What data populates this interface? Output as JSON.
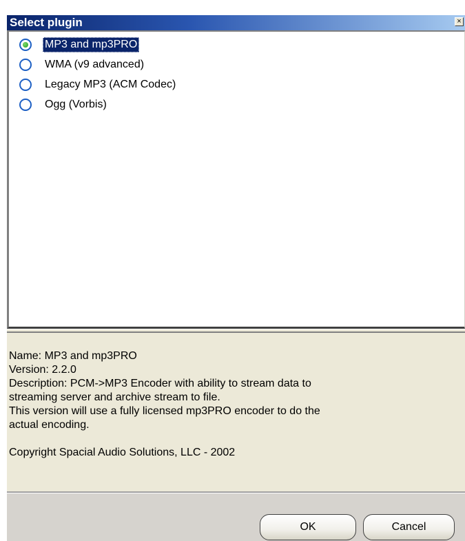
{
  "window": {
    "title": "Select plugin",
    "close_glyph": "×"
  },
  "plugins": [
    {
      "label": "MP3 and mp3PRO",
      "selected": true
    },
    {
      "label": "WMA (v9 advanced)",
      "selected": false
    },
    {
      "label": "Legacy MP3 (ACM Codec)",
      "selected": false
    },
    {
      "label": "Ogg (Vorbis)",
      "selected": false
    }
  ],
  "info": {
    "name": "Name: MP3 and mp3PRO",
    "version": "Version: 2.2.0",
    "description_1": "Description: PCM->MP3 Encoder with ability to stream data to",
    "description_2": "streaming server and archive stream to file.",
    "description_3": "This version will use a fully licensed mp3PRO encoder to do the",
    "description_4": "actual encoding.",
    "copyright": "Copyright Spacial Audio Solutions, LLC - 2002"
  },
  "buttons": {
    "ok": "OK",
    "cancel": "Cancel"
  },
  "colors": {
    "title_start": "#0a246a",
    "selection": "#0a246a",
    "radio_border": "#1c5fc4",
    "radio_dot": "#21a121"
  }
}
